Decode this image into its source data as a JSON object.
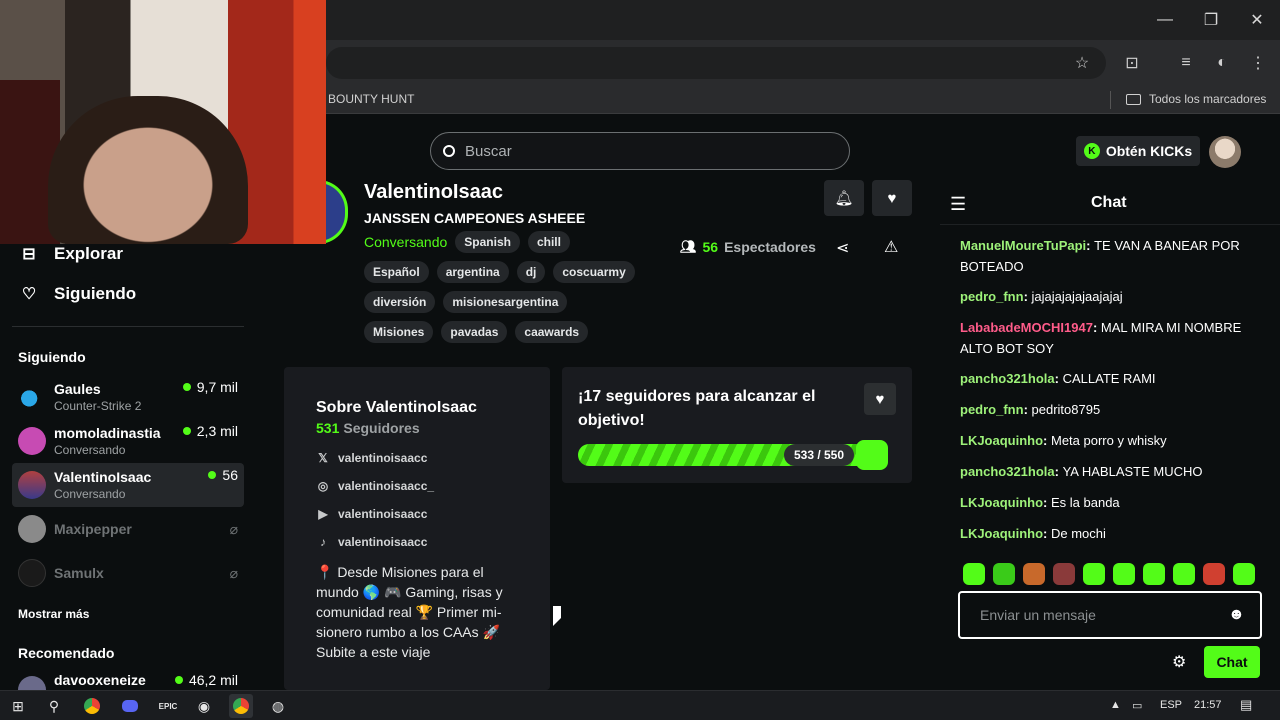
{
  "browser": {
    "bookmark_item": "BOUNTY HUNT",
    "all_bookmarks": "Todos los marcadores"
  },
  "topnav": {
    "search_placeholder": "Buscar",
    "kicks_button": "Obtén KICKs",
    "kicks_badge": "K"
  },
  "sidebar": {
    "explore": "Explorar",
    "following_nav": "Siguiendo",
    "following_title": "Siguiendo",
    "channels": [
      {
        "name": "Gaules",
        "sub": "Counter-Strike 2",
        "viewers": "9,7 mil",
        "live": true,
        "color": "#2aa7e8"
      },
      {
        "name": "momoladinastia",
        "sub": "Conversando",
        "viewers": "2,3 mil",
        "live": true,
        "color": "#c74bb3"
      },
      {
        "name": "ValentinoIsaac",
        "sub": "Conversando",
        "viewers": "56",
        "live": true,
        "color": "#b04040"
      },
      {
        "name": "Maxipepper",
        "sub": "",
        "viewers": "",
        "live": false,
        "color": "#8a8a8a"
      },
      {
        "name": "Samulx",
        "sub": "",
        "viewers": "",
        "live": false,
        "color": "#1a1a1a"
      }
    ],
    "show_more": "Mostrar más",
    "recommended_title": "Recomendado",
    "recommended": [
      {
        "name": "davooxeneize",
        "viewers": "46,2 mil"
      }
    ]
  },
  "stream": {
    "channel_name": "ValentinoIsaac",
    "title": "JANSSEN CAMPEONES ASHEEE",
    "category": "Conversando",
    "tags": [
      "Spanish",
      "chill",
      "Español",
      "argentina",
      "dj",
      "coscuarmy",
      "diversión",
      "misionesargentina",
      "Misiones",
      "pavadas",
      "caawards"
    ],
    "viewers_count": "56",
    "viewers_label": "Espectadores"
  },
  "about": {
    "title": "Sobre ValentinoIsaac",
    "followers_count": "531",
    "followers_label": "Seguidores",
    "socials": [
      {
        "icon": "x-icon",
        "glyph": "𝕏",
        "handle": "valentinoisaacc"
      },
      {
        "icon": "instagram-icon",
        "glyph": "◎",
        "handle": "valentinoisaacc_"
      },
      {
        "icon": "youtube-icon",
        "glyph": "▶",
        "handle": "valentinoisaacc"
      },
      {
        "icon": "tiktok-icon",
        "glyph": "♪",
        "handle": "valentinoisaacc"
      }
    ],
    "bio_lines": [
      "📍 Desde Misiones para el",
      "mundo 🌎 🎮 Gaming, risas y",
      "comunidad real 🏆 Primer mi-",
      "sionero rumbo a los CAAs 🚀",
      "Subite a este viaje"
    ]
  },
  "goal": {
    "title_line1": "¡17 seguidores para alcanzar el",
    "title_line2": "objetivo!",
    "current": 533,
    "target": 550,
    "label": "533 / 550"
  },
  "chat": {
    "title": "Chat",
    "messages": [
      {
        "user": "ManuelMoureTuPapi",
        "color": "#9ef27a",
        "text": "TE VAN A BANEAR POR",
        "text2": "BOTEADO"
      },
      {
        "user": "pedro_fnn",
        "color": "#9ef27a",
        "text": "jajajajajajaajajaj",
        "text2": ""
      },
      {
        "user": "LababadeMOCHI1947",
        "color": "#ff5c8a",
        "text": "MAL MIRA MI NOMBRE",
        "text2": "ALTO BOT SOY"
      },
      {
        "user": "pancho321hola",
        "color": "#9ef27a",
        "text": "CALLATE RAMI",
        "text2": ""
      },
      {
        "user": "pedro_fnn",
        "color": "#9ef27a",
        "text": "pedrito8795",
        "text2": ""
      },
      {
        "user": "LKJoaquinho",
        "color": "#9ef27a",
        "text": "Meta porro y whisky",
        "text2": ""
      },
      {
        "user": "pancho321hola",
        "color": "#9ef27a",
        "text": "YA HABLASTE MUCHO",
        "text2": ""
      },
      {
        "user": "LKJoaquinho",
        "color": "#9ef27a",
        "text": "Es la banda",
        "text2": ""
      },
      {
        "user": "LKJoaquinho",
        "color": "#9ef27a",
        "text": "De mochi",
        "text2": ""
      }
    ],
    "emotes": [
      "#53fc18",
      "#3acb19",
      "#c8692b",
      "#8a3a3a",
      "#53fc18",
      "#53fc18",
      "#53fc18",
      "#53fc18",
      "#d04030",
      "#53fc18"
    ],
    "input_placeholder": "Enviar un mensaje",
    "send_label": "Chat"
  },
  "taskbar": {
    "lang": "ESP",
    "time": "21:57"
  },
  "colors": {
    "accent": "#53fc18",
    "bg": "#0b0e0f",
    "panel": "#191b1f"
  }
}
